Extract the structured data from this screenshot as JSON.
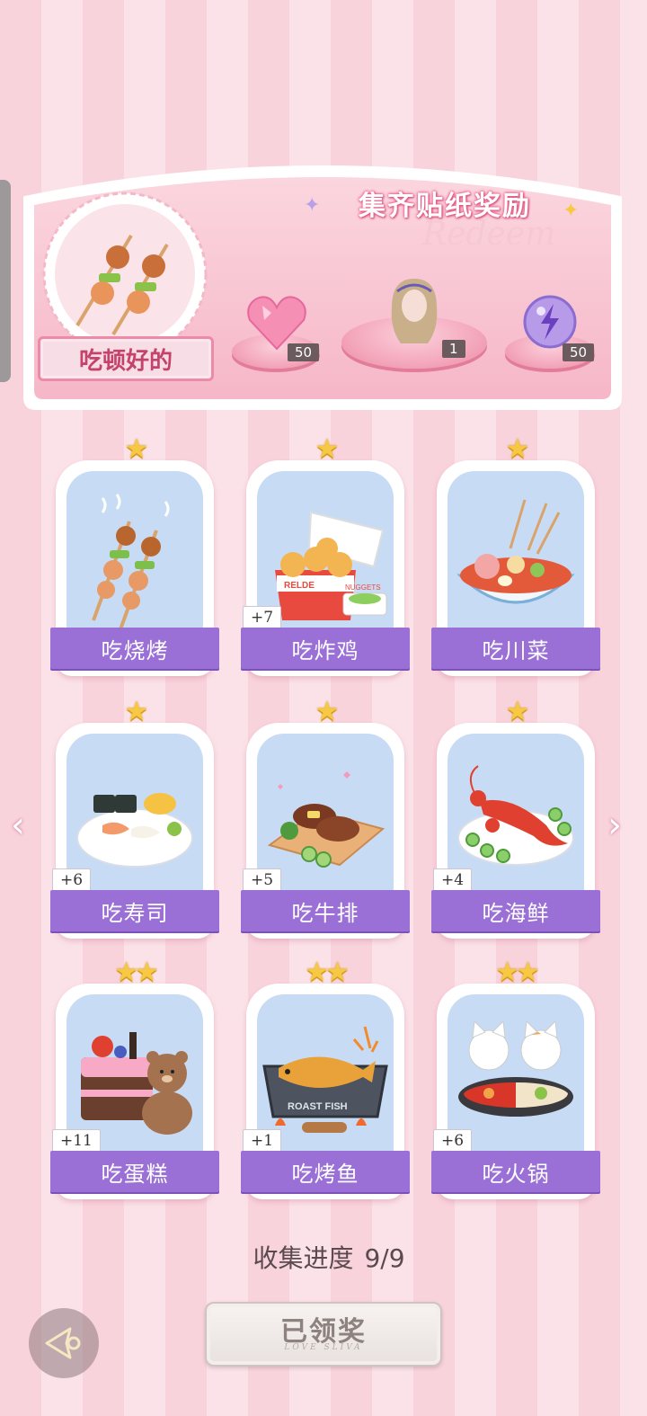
{
  "reward": {
    "title": "集齐贴纸奖励",
    "watermark": "Redeem",
    "badge_label": "吃顿好的",
    "items": [
      {
        "icon": "heart-gem-icon",
        "count": "50"
      },
      {
        "icon": "character-hair-icon",
        "count": "1"
      },
      {
        "icon": "energy-orb-icon",
        "count": "50"
      }
    ]
  },
  "cards": [
    {
      "label": "吃烧烤",
      "stars": "★",
      "plus": ""
    },
    {
      "label": "吃炸鸡",
      "stars": "★",
      "plus": "+7"
    },
    {
      "label": "吃川菜",
      "stars": "★",
      "plus": ""
    },
    {
      "label": "吃寿司",
      "stars": "★",
      "plus": "+6"
    },
    {
      "label": "吃牛排",
      "stars": "★",
      "plus": "+5"
    },
    {
      "label": "吃海鲜",
      "stars": "★",
      "plus": "+4"
    },
    {
      "label": "吃蛋糕",
      "stars": "★★",
      "plus": "+11"
    },
    {
      "label": "吃烤鱼",
      "stars": "★★",
      "plus": "+1"
    },
    {
      "label": "吃火锅",
      "stars": "★★",
      "plus": "+6"
    }
  ],
  "card_art_text": {
    "nuggets_box": "NUGGETS",
    "nuggets_brand": "RELDE",
    "roast_fish": "ROAST FISH"
  },
  "progress": {
    "label": "收集进度",
    "value": "9/9"
  },
  "claim_button": {
    "label": "已领奖",
    "subtitle": "LOVE SLIVA"
  },
  "nav": {
    "left": "‹",
    "right": "›"
  }
}
